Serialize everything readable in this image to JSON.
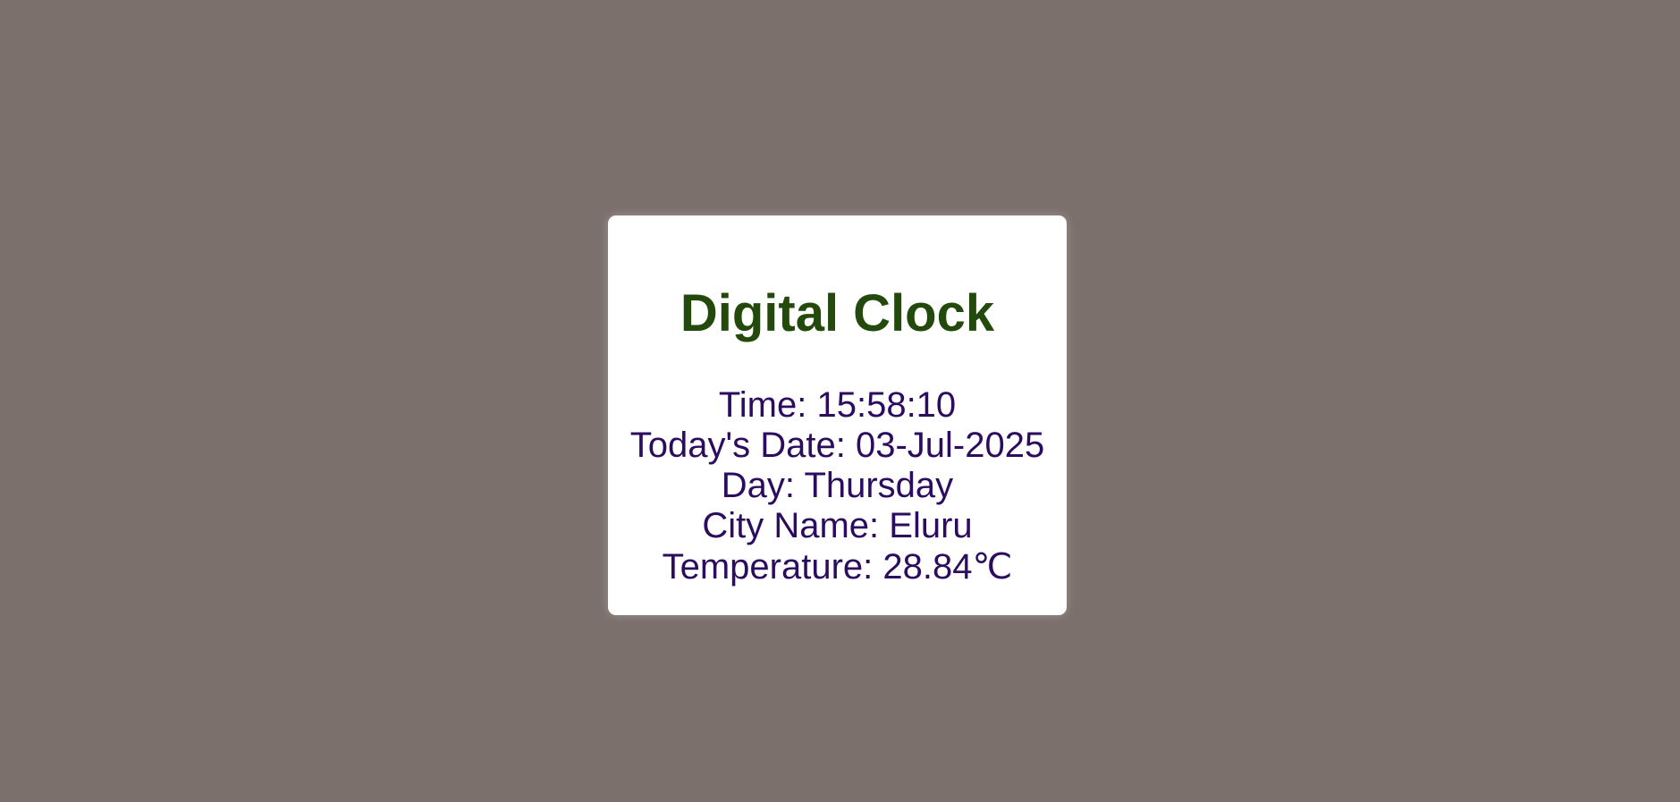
{
  "clock": {
    "title": "Digital Clock",
    "time_label": "Time: ",
    "time": "15:58:10",
    "date_label": "Today's Date: ",
    "date": "03-Jul-2025",
    "day_label": "Day: ",
    "day": "Thursday",
    "city_label": "City Name: ",
    "city": "Eluru",
    "temperature_label": "Temperature: ",
    "temperature": "28.84",
    "temperature_unit": "℃"
  },
  "colors": {
    "background": "#7c706c",
    "card": "#ffffff",
    "title": "#234a0c",
    "info_text": "#2c0c5e"
  }
}
